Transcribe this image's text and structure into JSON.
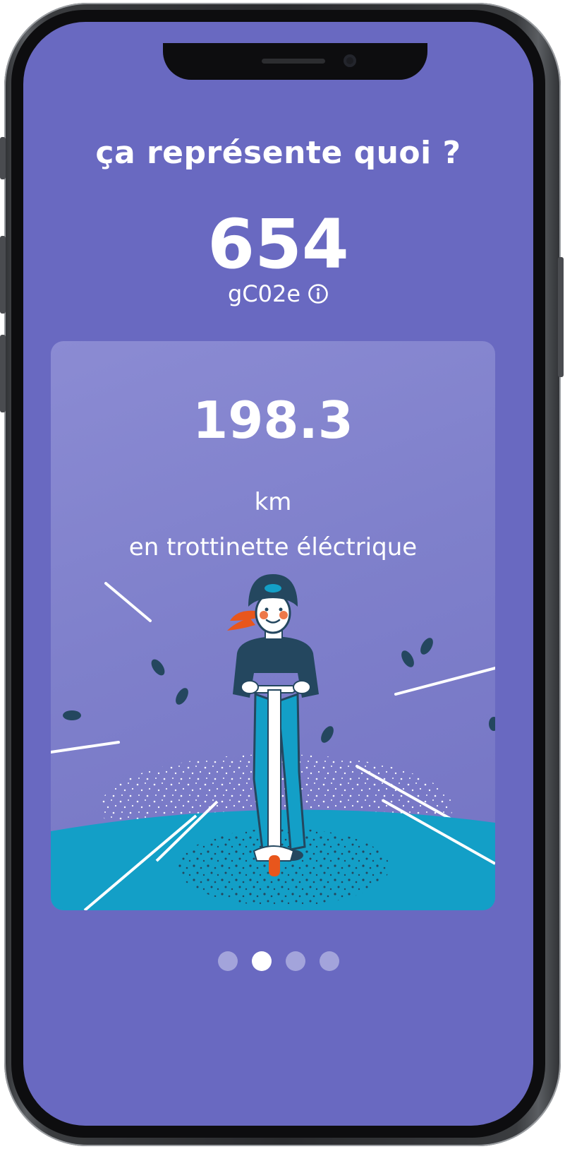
{
  "screen": {
    "title": "ça représente quoi ?",
    "emission_value": "654",
    "emission_unit": "gC02e",
    "info_icon": "info-circle-icon"
  },
  "card": {
    "equivalent_value": "198.3",
    "equivalent_unit": "km",
    "equivalent_description": "en trottinette éléctrique",
    "illustration": "woman-riding-electric-scooter"
  },
  "carousel": {
    "page_count": 4,
    "active_index": 1
  },
  "colors": {
    "background": "#6969c1",
    "card": "#8484cd",
    "road": "#139fc7",
    "navy": "#24475f",
    "accent_orange": "#e8561c"
  }
}
